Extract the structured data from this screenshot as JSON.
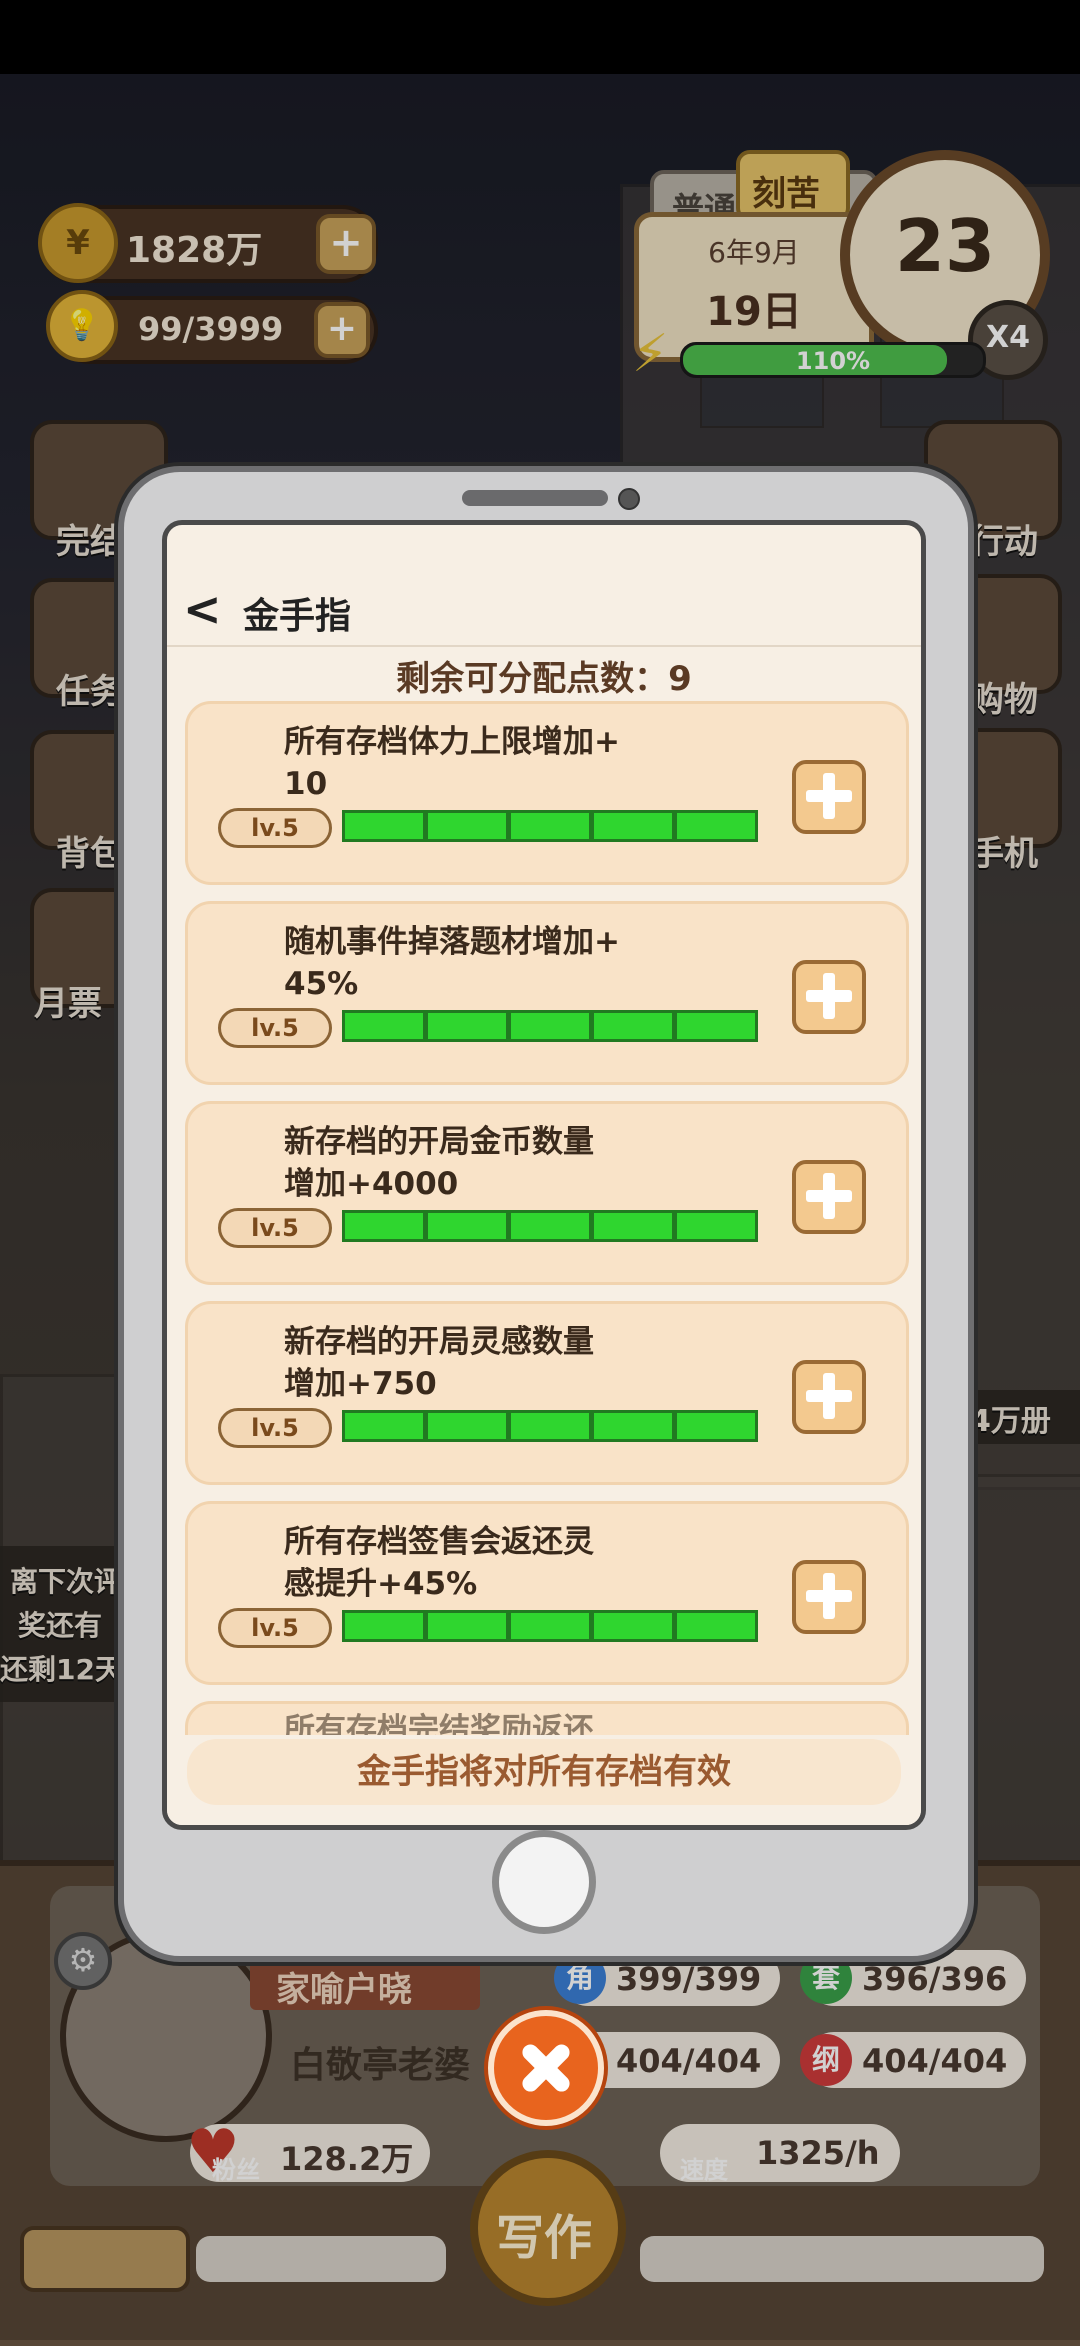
{
  "hud": {
    "coins": "1828万",
    "inspiration": "99/3999",
    "mode_normal": "普通",
    "mode_hard": "刻苦",
    "date_month": "6年9月",
    "date_day": "19日",
    "clock": "23",
    "speed_mult": "X4",
    "stamina_pct": "110%",
    "stamina_fill": 0.88
  },
  "side_left": [
    "完结",
    "任务",
    "背包",
    "月票"
  ],
  "side_right": [
    "行动",
    "购物",
    "手机"
  ],
  "side_right_extra": "4万册",
  "left_notice": [
    "离下次评",
    "奖还有",
    "还剩12天"
  ],
  "modal": {
    "back_label": "<",
    "title": "金手指",
    "points_label": "剩余可分配点数：",
    "points_value": "9",
    "footer_note": "金手指将对所有存档有效",
    "partial_next": "所有存档完结奖励返还",
    "items": [
      {
        "desc_line1": "所有存档体力上限增加+",
        "desc_line2": "10",
        "level": "lv.5",
        "filled": 5,
        "total": 5
      },
      {
        "desc_line1": "随机事件掉落题材增加+",
        "desc_line2": "45%",
        "level": "lv.5",
        "filled": 5,
        "total": 5
      },
      {
        "desc_line1": "新存档的开局金币数量",
        "desc_line2": "增加+4000",
        "level": "lv.5",
        "filled": 5,
        "total": 5
      },
      {
        "desc_line1": "新存档的开局灵感数量",
        "desc_line2": "增加+750",
        "level": "lv.5",
        "filled": 5,
        "total": 5
      },
      {
        "desc_line1": "所有存档签售会返还灵",
        "desc_line2": "感提升+45%",
        "level": "lv.5",
        "filled": 5,
        "total": 5
      }
    ]
  },
  "bottom": {
    "title_badge": "家喻户晓",
    "author_name": "白敬亭老婆",
    "stats": [
      {
        "icon": "角",
        "value": "399/399",
        "color": "#3b7fd6"
      },
      {
        "icon": "套",
        "value": "396/396",
        "color": "#3aa04a"
      },
      {
        "icon": "",
        "value": "404/404",
        "color": "#d59a2a"
      },
      {
        "icon": "纲",
        "value": "404/404",
        "color": "#cf3b3b"
      }
    ],
    "fans_label": "粉丝",
    "fans_value": "128.2万",
    "speed_label": "速度",
    "speed_value": "1325/h",
    "write_label": "写作"
  },
  "colors": {
    "accent_green": "#2fd62f",
    "card_bg": "#f9e3c8",
    "close_button": "#e8641e"
  }
}
